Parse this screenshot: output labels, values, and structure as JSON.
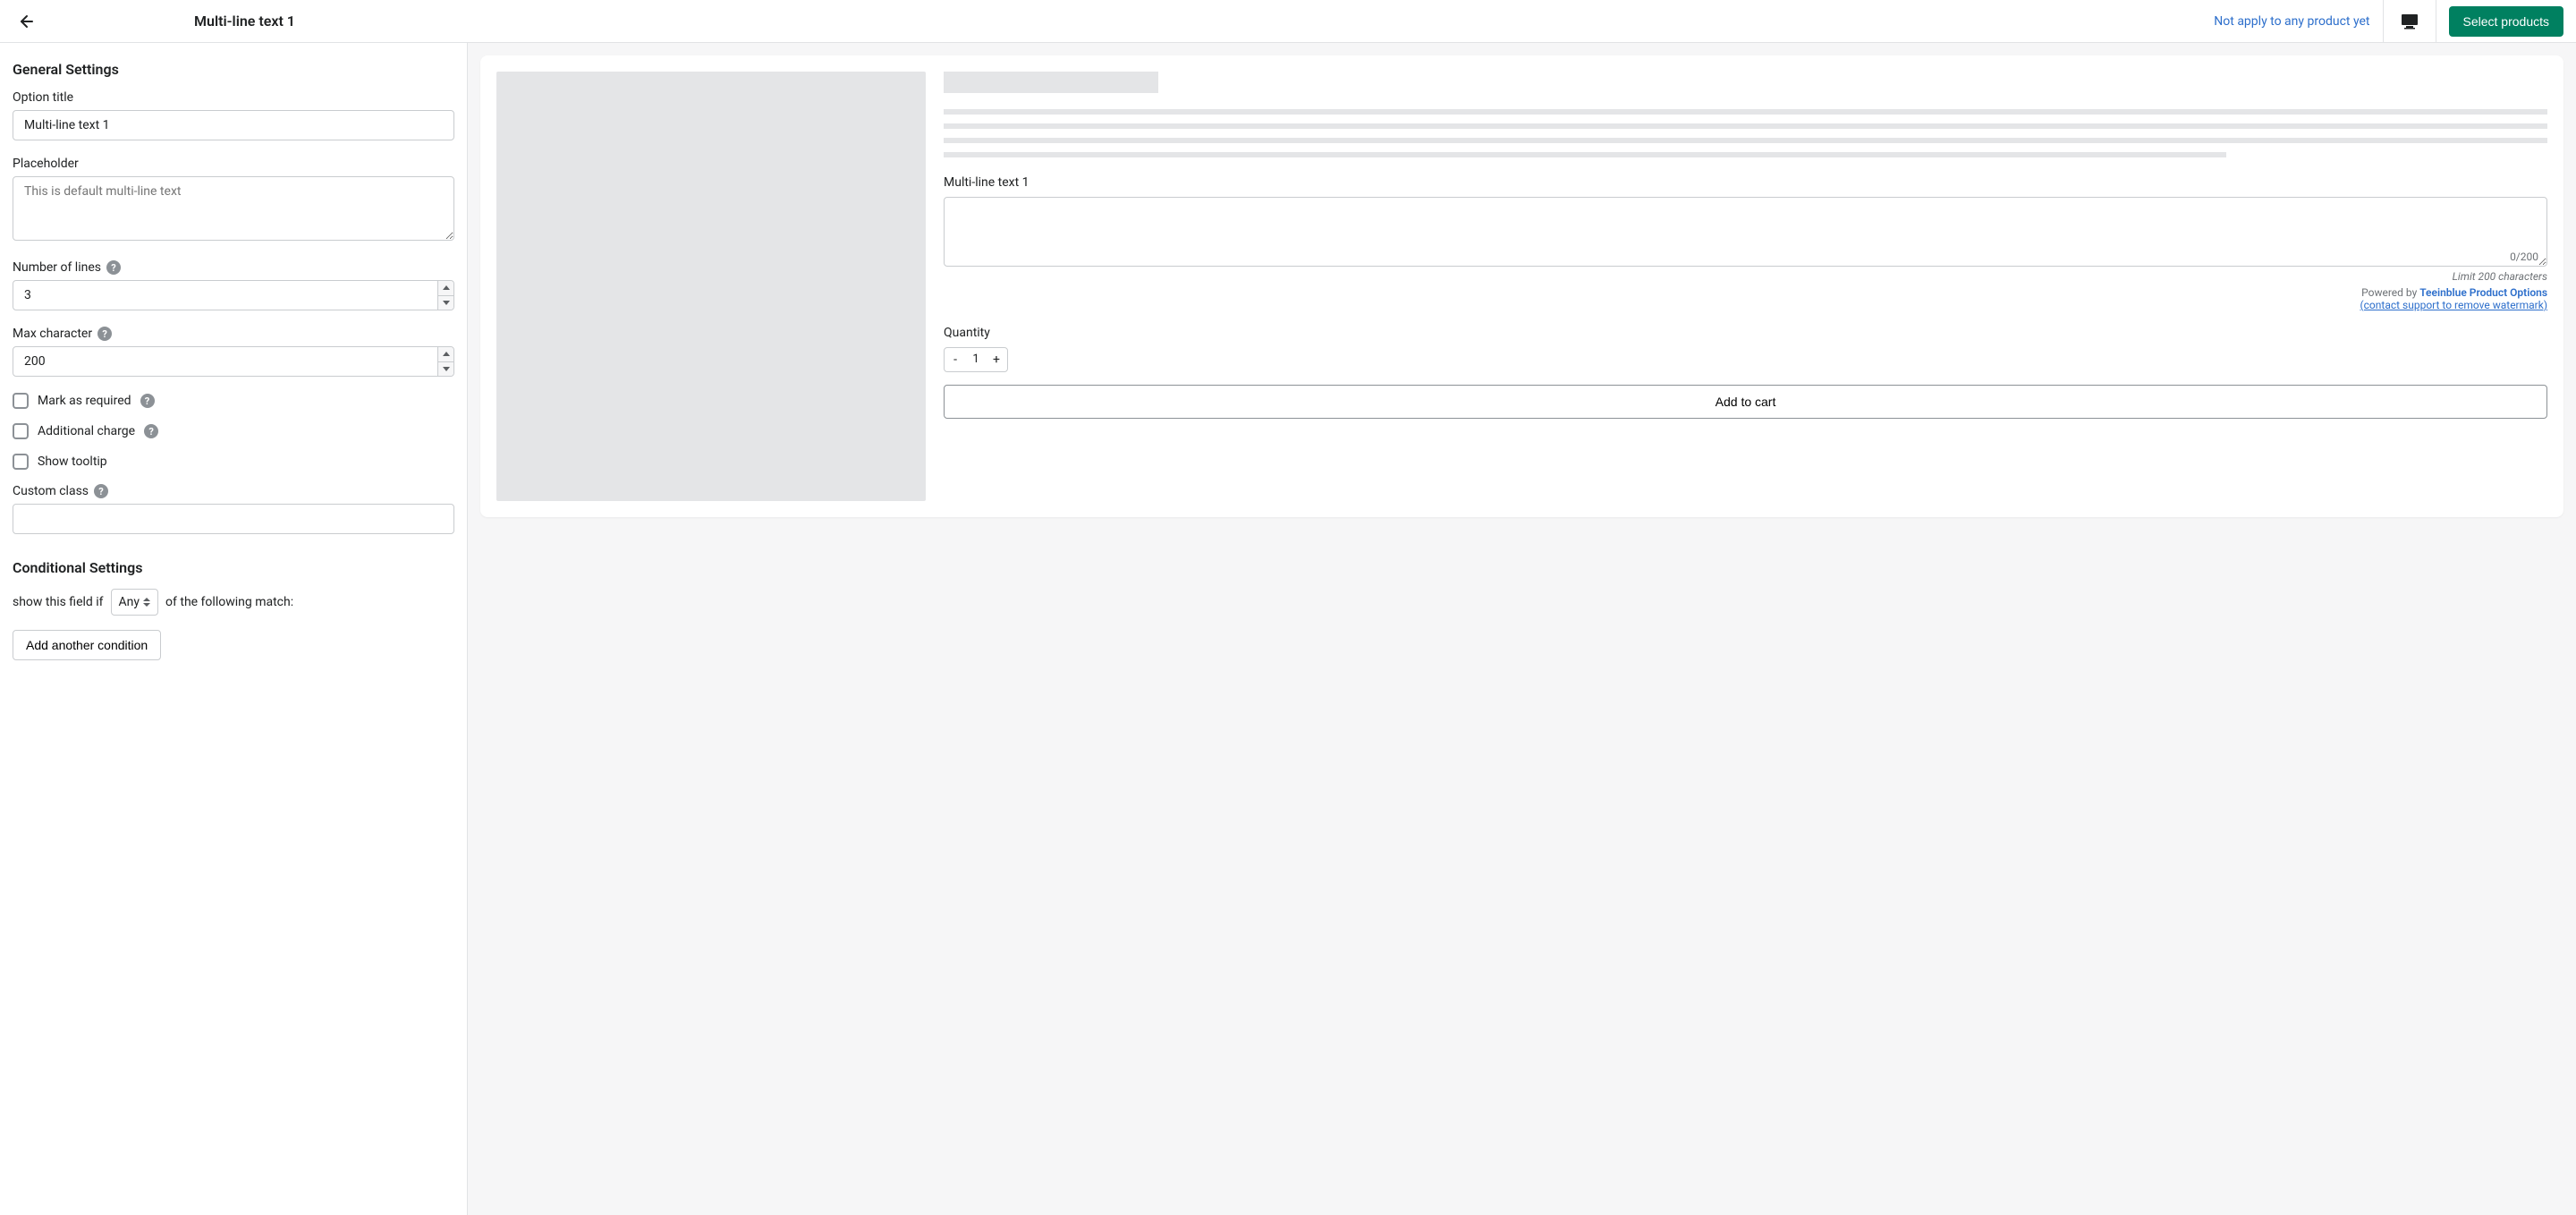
{
  "header": {
    "page_title": "Multi-line text 1",
    "apply_status": "Not apply to any product yet",
    "select_products_label": "Select products"
  },
  "sidebar": {
    "general_heading": "General Settings",
    "option_title_label": "Option title",
    "option_title_value": "Multi-line text 1",
    "placeholder_label": "Placeholder",
    "placeholder_value": "This is default multi-line text",
    "number_of_lines_label": "Number of lines",
    "number_of_lines_value": "3",
    "max_character_label": "Max character",
    "max_character_value": "200",
    "mark_required_label": "Mark as required",
    "additional_charge_label": "Additional charge",
    "show_tooltip_label": "Show tooltip",
    "custom_class_label": "Custom class",
    "custom_class_value": "",
    "conditional_heading": "Conditional Settings",
    "cond_prefix": "show this field if",
    "cond_select": "Any",
    "cond_suffix": "of the following match:",
    "add_condition_label": "Add another condition"
  },
  "preview": {
    "field_label": "Multi-line text 1",
    "char_counter": "0/200",
    "limit_text": "Limit 200 characters",
    "powered_prefix": "Powered by ",
    "powered_brand": "Teeinblue Product Options",
    "watermark_link": "(contact support to remove watermark)",
    "quantity_label": "Quantity",
    "quantity_value": "1",
    "add_to_cart_label": "Add to cart"
  }
}
